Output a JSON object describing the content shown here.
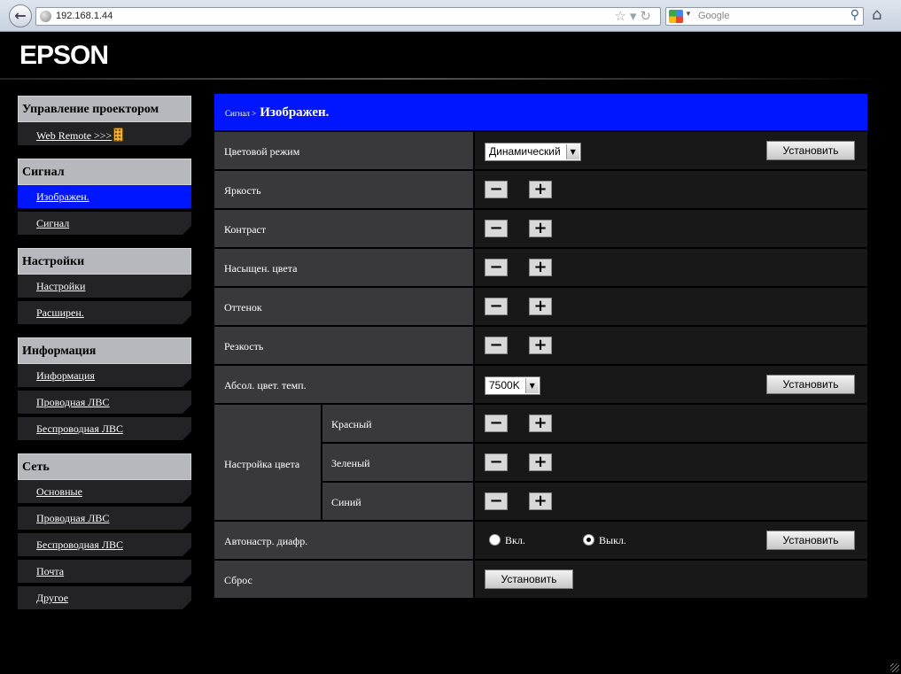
{
  "browser": {
    "url": "192.168.1.44",
    "search_placeholder": "Google"
  },
  "header": {
    "logo": "EPSON"
  },
  "sidebar": {
    "groups": [
      {
        "title": "Управление проектором",
        "items": [
          {
            "label": "Web Remote >>>"
          }
        ]
      },
      {
        "title": "Сигнал",
        "items": [
          {
            "label": "Изображен.",
            "active": true
          },
          {
            "label": "Сигнал"
          }
        ]
      },
      {
        "title": "Настройки",
        "items": [
          {
            "label": "Настройки"
          },
          {
            "label": "Расширен."
          }
        ]
      },
      {
        "title": "Информация",
        "items": [
          {
            "label": "Информация"
          },
          {
            "label": "Проводная ЛВС"
          },
          {
            "label": "Беспроводная ЛВС"
          }
        ]
      },
      {
        "title": "Сеть",
        "items": [
          {
            "label": "Основные"
          },
          {
            "label": "Проводная ЛВС"
          },
          {
            "label": "Беспроводная ЛВС"
          },
          {
            "label": "Почта"
          },
          {
            "label": "Другое"
          }
        ]
      }
    ]
  },
  "main": {
    "breadcrumb": "Сигнал >",
    "title": "Изображен.",
    "set_label": "Установить",
    "minus": "−",
    "plus": "+",
    "color_mode": {
      "label": "Цветовой режим",
      "value": "Динамический"
    },
    "brightness": {
      "label": "Яркость"
    },
    "contrast": {
      "label": "Контраст"
    },
    "saturation": {
      "label": "Насыщен. цвета"
    },
    "tint": {
      "label": "Оттенок"
    },
    "sharpness": {
      "label": "Резкость"
    },
    "color_temp": {
      "label": "Абсол. цвет. темп.",
      "value": "7500K"
    },
    "color_adjust": {
      "label": "Настройка цвета",
      "red": "Красный",
      "green": "Зеленый",
      "blue": "Синий"
    },
    "auto_iris": {
      "label": "Автонастр. диафр.",
      "on": "Вкл.",
      "off": "Выкл.",
      "selected": "off"
    },
    "reset": {
      "label": "Сброс"
    }
  }
}
